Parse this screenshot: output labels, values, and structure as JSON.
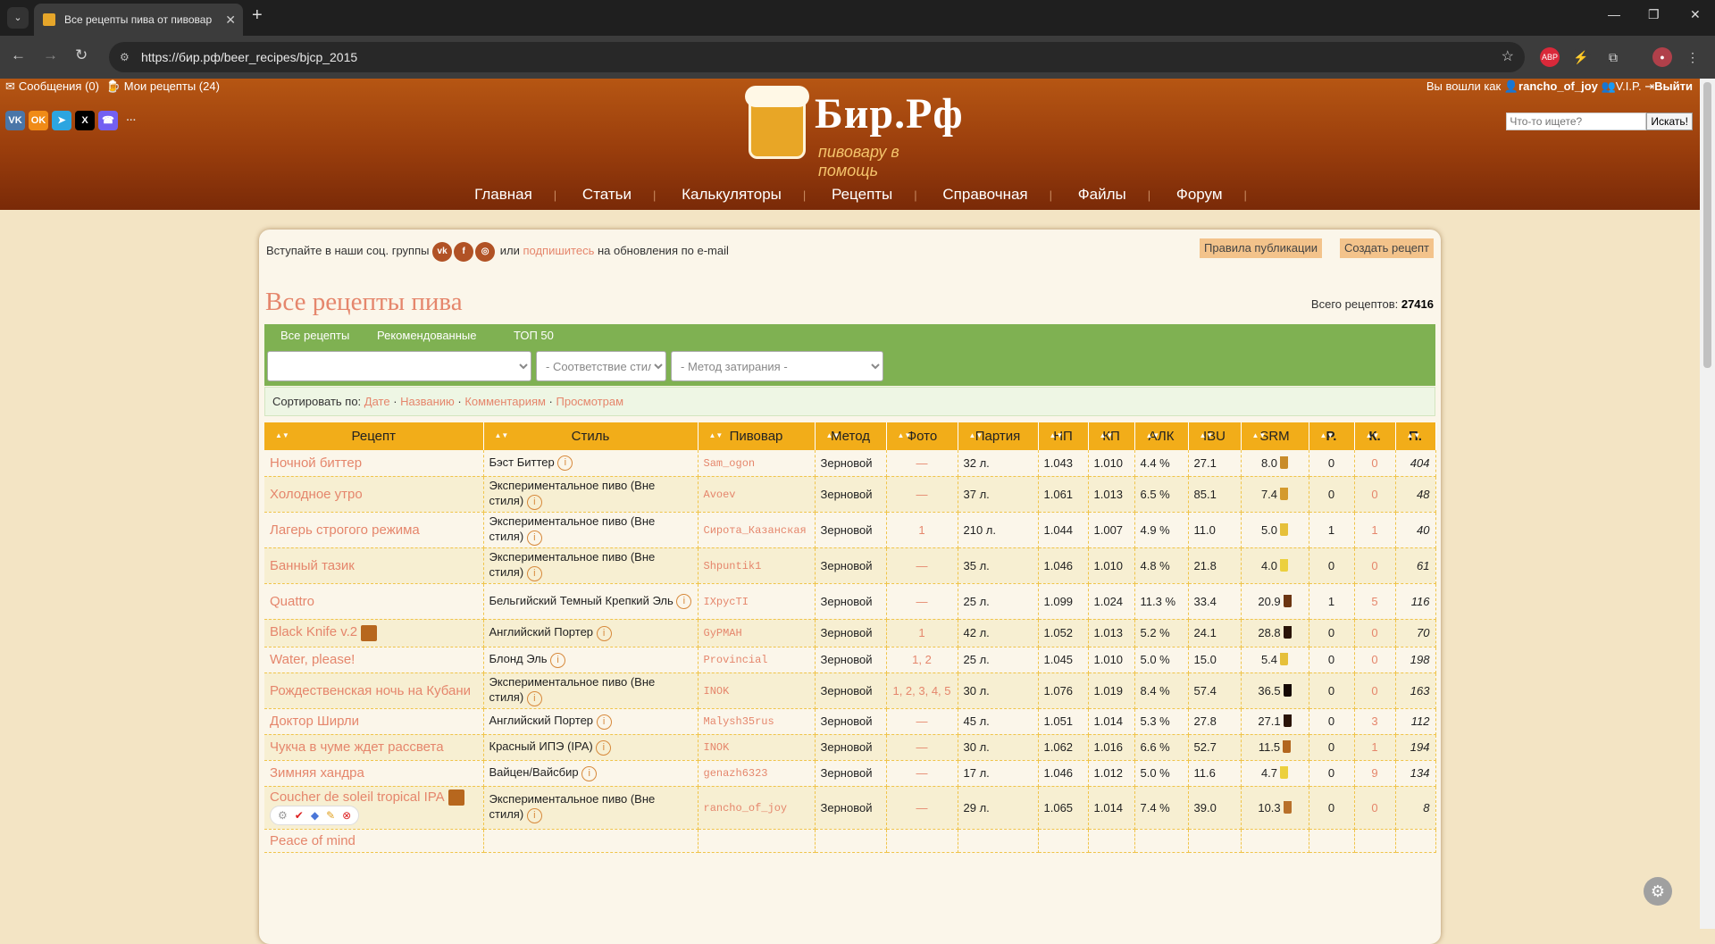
{
  "browser": {
    "tab_title": "Все рецепты пива от пивовар",
    "url": "https://бир.рф/beer_recipes/bjcp_2015"
  },
  "header": {
    "messages": "Сообщения (0)",
    "my_recipes": "Мои рецепты (24)",
    "logged_as": "Вы вошли как",
    "username": "rancho_of_joy",
    "vip": "V.I.P.",
    "logout": "Выйти",
    "logo_name": "Бир.Рф",
    "logo_slogan": "пивовару в помощь",
    "search_placeholder": "Что-то ищете?",
    "search_button": "Искать!",
    "nav": [
      "Главная",
      "Статьи",
      "Калькуляторы",
      "Рецепты",
      "Справочная",
      "Файлы",
      "Форум"
    ]
  },
  "panel": {
    "social_text_1": "Вступайте в наши соц. группы",
    "social_text_2": "или",
    "subscribe_link": "подпишитесь",
    "social_text_3": "на обновления по e-mail",
    "rules_button": "Правила публикации",
    "create_button": "Создать рецепт",
    "title": "Все рецепты пива",
    "total_label": "Всего рецептов:",
    "total_value": "27416",
    "tabs": [
      "Все рецепты",
      "Рекомендованные",
      "ТОП 50"
    ],
    "filter_style_fit": "- Соответствие стилю -",
    "filter_mash": "- Метод затирания -",
    "sort_label": "Сортировать по:",
    "sort_options": [
      "Дате",
      "Названию",
      "Комментариям",
      "Просмотрам"
    ]
  },
  "table": {
    "columns": [
      "Рецепт",
      "Стиль",
      "Пивовар",
      "Метод",
      "Фото",
      "Партия",
      "НП",
      "КП",
      "АЛК",
      "IBU",
      "SRM",
      "Р.",
      "К.",
      "П."
    ],
    "rows": [
      {
        "name": "Ночной биттер",
        "style": "Бэст Биттер",
        "brewer": "Sam_ogon",
        "method": "Зерновой",
        "photo": "—",
        "batch": "32 л.",
        "og": "1.043",
        "fg": "1.010",
        "abv": "4.4 %",
        "ibu": "27.1",
        "srm": "8.0",
        "srm_color": "#c98c2a",
        "r": "0",
        "k": "0",
        "p": "404",
        "copy": false
      },
      {
        "name": "Холодное утро",
        "style": "Экспериментальное пиво (Вне стиля)",
        "brewer": "Avoev",
        "method": "Зерновой",
        "photo": "—",
        "batch": "37 л.",
        "og": "1.061",
        "fg": "1.013",
        "abv": "6.5 %",
        "ibu": "85.1",
        "srm": "7.4",
        "srm_color": "#d49a2c",
        "r": "0",
        "k": "0",
        "p": "48",
        "copy": false
      },
      {
        "name": "Лагерь строгого режима",
        "style": "Экспериментальное пиво (Вне стиля)",
        "brewer": "Сирота_Казанская",
        "method": "Зерновой",
        "photo": "1",
        "batch": "210 л.",
        "og": "1.044",
        "fg": "1.007",
        "abv": "4.9 %",
        "ibu": "11.0",
        "srm": "5.0",
        "srm_color": "#e6c03a",
        "r": "1",
        "k": "1",
        "p": "40",
        "copy": false
      },
      {
        "name": "Банный тазик",
        "style": "Экспериментальное пиво (Вне стиля)",
        "brewer": "Shpuntik1",
        "method": "Зерновой",
        "photo": "—",
        "batch": "35 л.",
        "og": "1.046",
        "fg": "1.010",
        "abv": "4.8 %",
        "ibu": "21.8",
        "srm": "4.0",
        "srm_color": "#ecd03e",
        "r": "0",
        "k": "0",
        "p": "61",
        "copy": false
      },
      {
        "name": "Quattro",
        "style": "Бельгийский Темный Крепкий Эль",
        "brewer": "IXрусTI",
        "method": "Зерновой",
        "photo": "—",
        "batch": "25 л.",
        "og": "1.099",
        "fg": "1.024",
        "abv": "11.3 %",
        "ibu": "33.4",
        "srm": "20.9",
        "srm_color": "#6b3512",
        "r": "1",
        "k": "5",
        "p": "116",
        "copy": false
      },
      {
        "name": "Black Knife v.2",
        "style": "Английский Портер",
        "brewer": "GyPMAH",
        "method": "Зерновой",
        "photo": "1",
        "batch": "42 л.",
        "og": "1.052",
        "fg": "1.013",
        "abv": "5.2 %",
        "ibu": "24.1",
        "srm": "28.8",
        "srm_color": "#2a1408",
        "r": "0",
        "k": "0",
        "p": "70",
        "copy": true
      },
      {
        "name": "Water, please!",
        "style": "Блонд Эль",
        "brewer": "Provincial",
        "method": "Зерновой",
        "photo": "1, 2",
        "batch": "25 л.",
        "og": "1.045",
        "fg": "1.010",
        "abv": "5.0 %",
        "ibu": "15.0",
        "srm": "5.4",
        "srm_color": "#e6c03a",
        "r": "0",
        "k": "0",
        "p": "198",
        "copy": false
      },
      {
        "name": "Рождественская ночь на Кубани",
        "style": "Экспериментальное пиво (Вне стиля)",
        "brewer": "INOK",
        "method": "Зерновой",
        "photo": "1, 2, 3, 4, 5",
        "batch": "30 л.",
        "og": "1.076",
        "fg": "1.019",
        "abv": "8.4 %",
        "ibu": "57.4",
        "srm": "36.5",
        "srm_color": "#150905",
        "r": "0",
        "k": "0",
        "p": "163",
        "copy": false
      },
      {
        "name": "Доктор Ширли",
        "style": "Английский Портер",
        "brewer": "Malysh35rus",
        "method": "Зерновой",
        "photo": "—",
        "batch": "45 л.",
        "og": "1.051",
        "fg": "1.014",
        "abv": "5.3 %",
        "ibu": "27.8",
        "srm": "27.1",
        "srm_color": "#2a1408",
        "r": "0",
        "k": "3",
        "p": "112",
        "copy": false
      },
      {
        "name": "Чукча в чуме ждет рассвета",
        "style": "Красный ИПЭ (IPA)",
        "brewer": "INOK",
        "method": "Зерновой",
        "photo": "—",
        "batch": "30 л.",
        "og": "1.062",
        "fg": "1.016",
        "abv": "6.6 %",
        "ibu": "52.7",
        "srm": "11.5",
        "srm_color": "#b2661f",
        "r": "0",
        "k": "1",
        "p": "194",
        "copy": false
      },
      {
        "name": "Зимняя хандра",
        "style": "Вайцен/Вайсбир",
        "brewer": "genazh6323",
        "method": "Зерновой",
        "photo": "—",
        "batch": "17 л.",
        "og": "1.046",
        "fg": "1.012",
        "abv": "5.0 %",
        "ibu": "11.6",
        "srm": "4.7",
        "srm_color": "#ecd03e",
        "r": "0",
        "k": "9",
        "p": "134",
        "copy": false
      },
      {
        "name": "Coucher de soleil tropical IPA",
        "style": "Экспериментальное пиво (Вне стиля)",
        "brewer": "rancho_of_joy",
        "method": "Зерновой",
        "photo": "—",
        "batch": "29 л.",
        "og": "1.065",
        "fg": "1.014",
        "abv": "7.4 %",
        "ibu": "39.0",
        "srm": "10.3",
        "srm_color": "#b8702a",
        "r": "0",
        "k": "0",
        "p": "8",
        "copy": true,
        "tools": true
      },
      {
        "name": "Peace of mind",
        "style": "",
        "brewer": "",
        "method": "",
        "photo": "",
        "batch": "",
        "og": "",
        "fg": "",
        "abv": "",
        "ibu": "",
        "srm": "",
        "srm_color": "#ffffff",
        "r": "",
        "k": "",
        "p": "",
        "copy": false
      }
    ]
  }
}
